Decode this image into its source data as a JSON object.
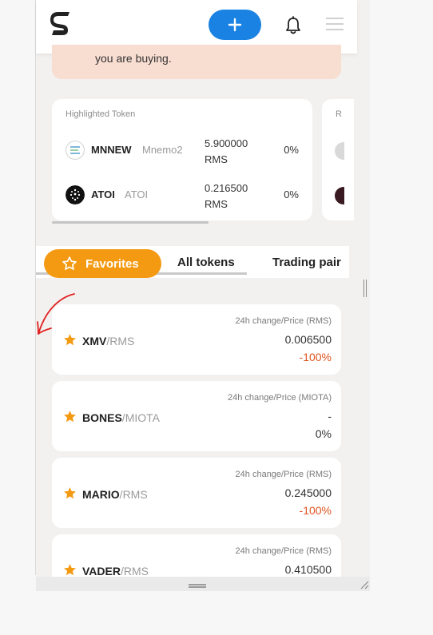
{
  "header": {
    "logo_letter": "S",
    "add_label": "+"
  },
  "banner": {
    "text": "you are buying."
  },
  "highlighted": {
    "title": "Highlighted Token",
    "tokens": [
      {
        "symbol": "MNNEW",
        "name": "Mnemo2",
        "price": "5.900000",
        "unit": "RMS",
        "change": "0%"
      },
      {
        "symbol": "ATOI",
        "name": "ATOI",
        "price": "0.216500",
        "unit": "RMS",
        "change": "0%"
      }
    ],
    "peek_title": "R"
  },
  "tabs": {
    "favorites": "Favorites",
    "all": "All tokens",
    "pairs": "Trading pair"
  },
  "pairs": [
    {
      "base": "XMV",
      "quote": "RMS",
      "label": "24h change/Price (RMS)",
      "price": "0.006500",
      "change": "-100%",
      "change_color": "#e0541f"
    },
    {
      "base": "BONES",
      "quote": "MIOTA",
      "label": "24h change/Price (MIOTA)",
      "price": "-",
      "change": "0%",
      "change_color": "#333333"
    },
    {
      "base": "MARIO",
      "quote": "RMS",
      "label": "24h change/Price (RMS)",
      "price": "0.245000",
      "change": "-100%",
      "change_color": "#e0541f"
    },
    {
      "base": "VADER",
      "quote": "RMS",
      "label": "24h change/Price (RMS)",
      "price": "0.410500",
      "change": "",
      "change_color": "#333333"
    }
  ],
  "colors": {
    "accent_blue": "#1a82e2",
    "accent_orange": "#f49a12",
    "negative": "#e0541f"
  }
}
